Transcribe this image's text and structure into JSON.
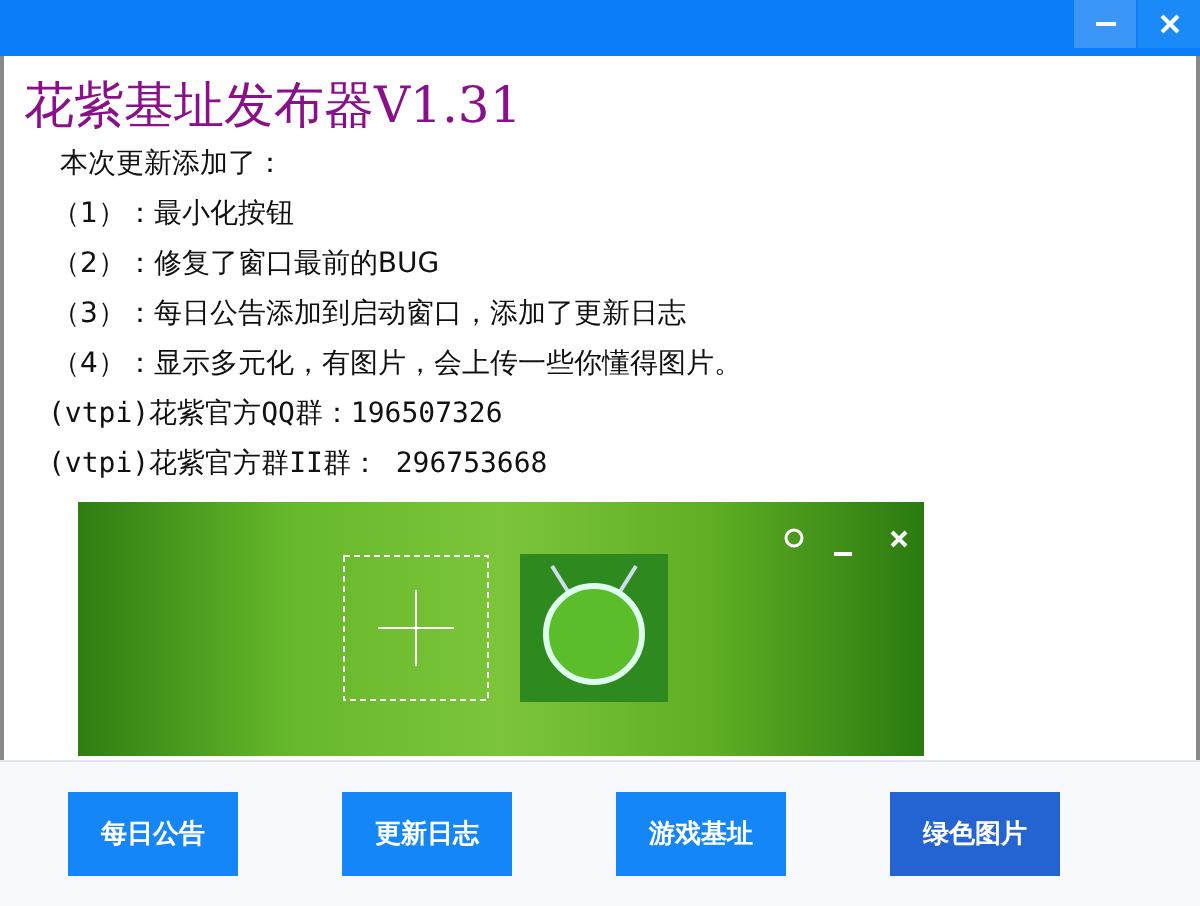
{
  "window": {
    "controls": [
      {
        "kind": "minimize"
      },
      {
        "kind": "close"
      }
    ]
  },
  "title": "花紫基址发布器V1.31",
  "notes": [
    {
      "kind": "plain",
      "text": "本次更新添加了："
    },
    {
      "kind": "item",
      "text": "（1）：最小化按钮"
    },
    {
      "kind": "item",
      "text": "（2）：修复了窗口最前的BUG"
    },
    {
      "kind": "item",
      "text": "（3）：每日公告添加到启动窗口，添加了更新日志"
    },
    {
      "kind": "item",
      "text": "（4）：显示多元化，有图片，会上传一些你懂得图片。"
    },
    {
      "kind": "group",
      "text": "(vtpi)花紫官方QQ群：196507326"
    },
    {
      "kind": "group",
      "text": "(vtpi)花紫官方群II群：  296753668"
    }
  ],
  "buttons": [
    {
      "label": "每日公告",
      "selected": false
    },
    {
      "label": "更新日志",
      "selected": false
    },
    {
      "label": "游戏基址",
      "selected": false
    },
    {
      "label": "绿色图片",
      "selected": true
    }
  ]
}
